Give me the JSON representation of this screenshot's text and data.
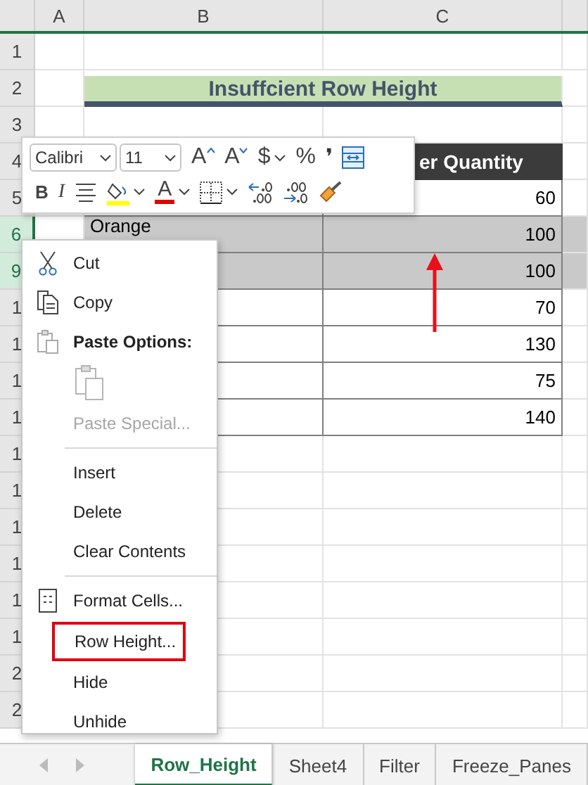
{
  "columns": [
    {
      "label": "A"
    },
    {
      "label": "B"
    },
    {
      "label": "C"
    }
  ],
  "rows": [
    {
      "number": "1",
      "selected": false,
      "kind": "blank"
    },
    {
      "number": "2",
      "selected": false,
      "kind": "title",
      "text": "Insuffcient Row Height"
    },
    {
      "number": "3",
      "selected": false,
      "kind": "blank"
    },
    {
      "number": "4",
      "selected": false,
      "kind": "header",
      "c": "er Quantity"
    },
    {
      "number": "5",
      "selected": false,
      "kind": "data",
      "c": "60"
    },
    {
      "number": "6",
      "selected": true,
      "kind": "data",
      "b": "Orange",
      "c": "100"
    },
    {
      "number": "9",
      "selected": true,
      "kind": "data",
      "c": "100"
    },
    {
      "number": "1",
      "selected": false,
      "kind": "data",
      "c": "70"
    },
    {
      "number": "1",
      "selected": false,
      "kind": "data",
      "c": "130"
    },
    {
      "number": "1",
      "selected": false,
      "kind": "data",
      "c": "75"
    },
    {
      "number": "1",
      "selected": false,
      "kind": "data",
      "c": "140"
    },
    {
      "number": "1",
      "selected": false,
      "kind": "blank"
    },
    {
      "number": "1",
      "selected": false,
      "kind": "blank"
    },
    {
      "number": "1",
      "selected": false,
      "kind": "blank"
    },
    {
      "number": "1",
      "selected": false,
      "kind": "blank"
    },
    {
      "number": "1",
      "selected": false,
      "kind": "blank"
    },
    {
      "number": "1",
      "selected": false,
      "kind": "blank"
    },
    {
      "number": "2",
      "selected": false,
      "kind": "blank"
    },
    {
      "number": "2",
      "selected": false,
      "kind": "blank"
    }
  ],
  "mini_toolbar": {
    "font": "Calibri",
    "size": "11",
    "row1": [
      {
        "kind": "grow",
        "glyph": "A"
      },
      {
        "kind": "shrink",
        "glyph": "A"
      },
      {
        "kind": "glyph",
        "glyph": "$"
      },
      {
        "kind": "caret"
      },
      {
        "kind": "glyph",
        "glyph": "%"
      },
      {
        "kind": "comma",
        "glyph": "❜"
      },
      {
        "kind": "merge"
      }
    ],
    "row2": [
      {
        "kind": "bold",
        "glyph": "B"
      },
      {
        "kind": "italic",
        "glyph": "I"
      },
      {
        "kind": "align"
      },
      {
        "kind": "fill"
      },
      {
        "kind": "caret"
      },
      {
        "kind": "fontcolor",
        "glyph": "A"
      },
      {
        "kind": "caret"
      },
      {
        "kind": "borders"
      },
      {
        "kind": "caret"
      },
      {
        "kind": "incdec"
      },
      {
        "kind": "decdec"
      },
      {
        "kind": "painter"
      }
    ]
  },
  "context_menu": [
    {
      "kind": "cut",
      "label": "Cut",
      "disabled": false,
      "highlighted": false
    },
    {
      "kind": "copy",
      "label": "Copy",
      "disabled": false,
      "highlighted": false
    },
    {
      "kind": "heading",
      "label": "Paste Options:"
    },
    {
      "kind": "paste-icon"
    },
    {
      "kind": "item",
      "label": "Paste Special...",
      "disabled": true,
      "highlighted": false
    },
    {
      "kind": "divider"
    },
    {
      "kind": "item",
      "label": "Insert",
      "disabled": false,
      "highlighted": false
    },
    {
      "kind": "item",
      "label": "Delete",
      "disabled": false,
      "highlighted": false
    },
    {
      "kind": "item",
      "label": "Clear Contents",
      "disabled": false,
      "highlighted": false
    },
    {
      "kind": "divider"
    },
    {
      "kind": "format",
      "label": "Format Cells...",
      "disabled": false,
      "highlighted": false
    },
    {
      "kind": "item",
      "label": "Row Height...",
      "disabled": false,
      "highlighted": true
    },
    {
      "kind": "item",
      "label": "Hide",
      "disabled": false,
      "highlighted": false
    },
    {
      "kind": "item",
      "label": "Unhide",
      "disabled": false,
      "highlighted": false
    }
  ],
  "sheet_tabs": [
    {
      "label": "Row_Height",
      "selected": true
    },
    {
      "label": "Sheet4",
      "selected": false
    },
    {
      "label": "Filter",
      "selected": false
    },
    {
      "label": "Freeze_Panes",
      "selected": false
    }
  ]
}
